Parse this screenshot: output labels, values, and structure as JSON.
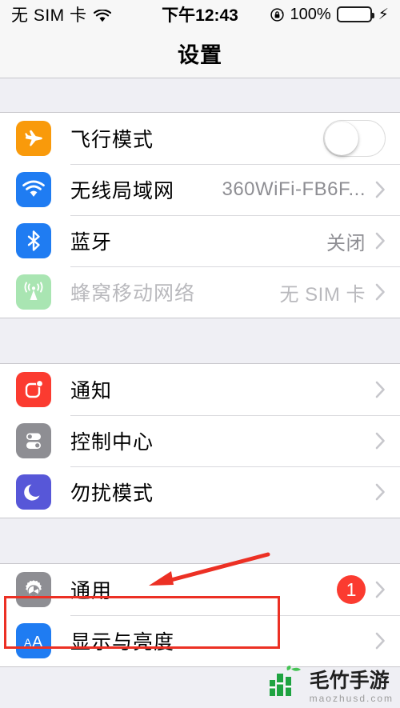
{
  "status_bar": {
    "carrier": "无 SIM 卡",
    "wifi_icon": "wifi-icon",
    "time": "下午12:43",
    "rotation_lock_icon": "rotation-lock-icon",
    "battery_percent": "100%",
    "battery_level": 100,
    "charging": true,
    "battery_color": "#35d44a"
  },
  "nav": {
    "title": "设置"
  },
  "groups": [
    {
      "name": "connectivity",
      "rows": [
        {
          "key": "airplane-mode",
          "label": "飞行模式",
          "icon": "airplane-icon",
          "icon_color": "#f99a0b",
          "accessory": "toggle",
          "toggle_on": false,
          "value": "",
          "disabled": false
        },
        {
          "key": "wifi",
          "label": "无线局域网",
          "icon": "wifi-icon",
          "icon_color": "#1f7cf2",
          "accessory": "chevron",
          "value": "360WiFi-FB6F...",
          "disabled": false
        },
        {
          "key": "bluetooth",
          "label": "蓝牙",
          "icon": "bluetooth-icon",
          "icon_color": "#1f7cf2",
          "accessory": "chevron",
          "value": "关闭",
          "disabled": false
        },
        {
          "key": "cellular",
          "label": "蜂窝移动网络",
          "icon": "cellular-icon",
          "icon_color": "#a9e5b2",
          "accessory": "chevron",
          "value": "无 SIM 卡",
          "disabled": true
        }
      ]
    },
    {
      "name": "notifications",
      "rows": [
        {
          "key": "notifications",
          "label": "通知",
          "icon": "notification-icon",
          "icon_color": "#fb3b30",
          "accessory": "chevron",
          "value": "",
          "disabled": false
        },
        {
          "key": "control-center",
          "label": "控制中心",
          "icon": "control-center-icon",
          "icon_color": "#8e8e93",
          "accessory": "chevron",
          "value": "",
          "disabled": false
        },
        {
          "key": "do-not-disturb",
          "label": "勿扰模式",
          "icon": "moon-icon",
          "icon_color": "#5757d8",
          "accessory": "chevron",
          "value": "",
          "disabled": false
        }
      ]
    },
    {
      "name": "system",
      "rows": [
        {
          "key": "general",
          "label": "通用",
          "icon": "gear-icon",
          "icon_color": "#8e8e93",
          "accessory": "chevron",
          "badge": "1",
          "value": "",
          "disabled": false,
          "highlighted": true
        },
        {
          "key": "display-brightness",
          "label": "显示与亮度",
          "icon": "text-size-icon",
          "icon_color": "#1f7cf2",
          "accessory": "chevron",
          "value": "",
          "disabled": false
        }
      ]
    }
  ],
  "annotations": {
    "highlight_color": "#ec3024",
    "arrow": "points-to-general-row",
    "rect_target": "general-row"
  },
  "watermark": {
    "title": "毛竹手游",
    "subtitle": "maozhusd.com",
    "logo_color": "#19a13c"
  }
}
